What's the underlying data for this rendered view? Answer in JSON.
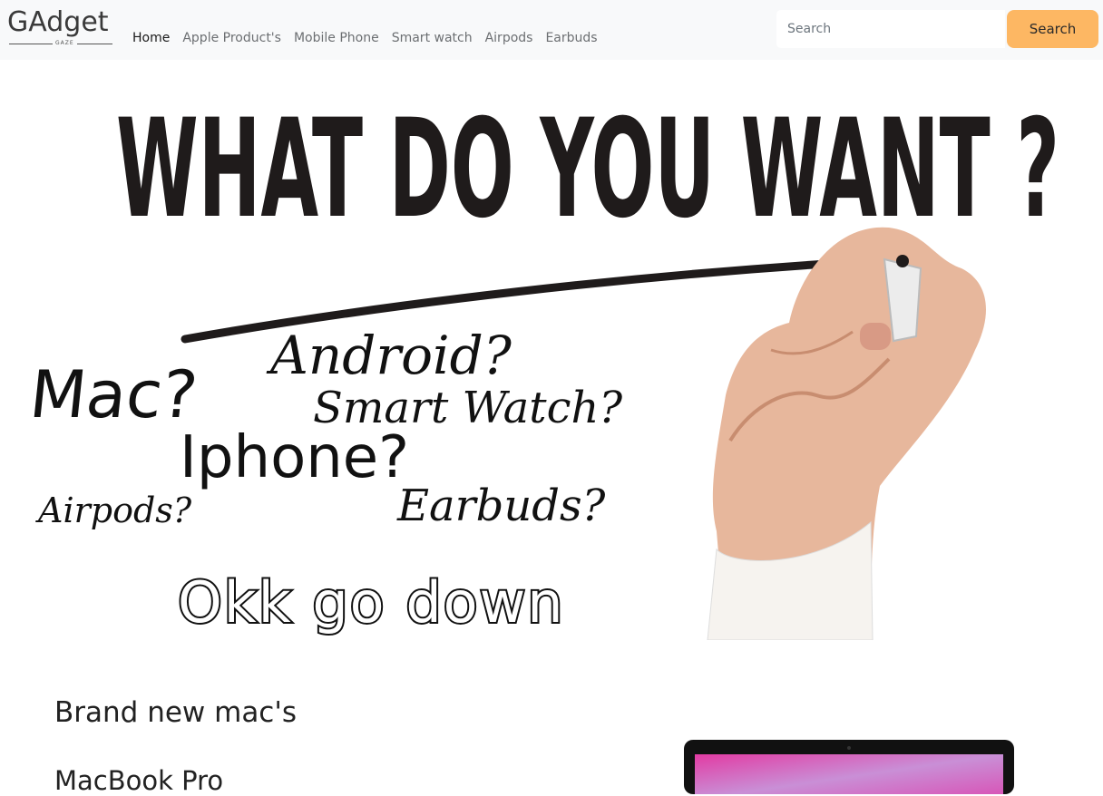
{
  "brand": {
    "name": "GAdget",
    "sub": "GAZE"
  },
  "nav": [
    {
      "label": "Home",
      "active": true
    },
    {
      "label": "Apple Product's",
      "active": false
    },
    {
      "label": "Mobile Phone",
      "active": false
    },
    {
      "label": "Smart watch",
      "active": false
    },
    {
      "label": "Airpods",
      "active": false
    },
    {
      "label": "Earbuds",
      "active": false
    }
  ],
  "search": {
    "placeholder": "Search",
    "button_label": "Search"
  },
  "hero": {
    "headline": "WHAT DO YOU WANT ?",
    "words": {
      "android": "Android?",
      "mac": "Mac?",
      "smartwatch": "Smart Watch?",
      "iphone": "Iphone?",
      "airpods": "Airpods?",
      "earbuds": "Earbuds?"
    },
    "cta": "Okk go down"
  },
  "content": {
    "section_title": "Brand new mac's",
    "product_title": "MacBook Pro"
  },
  "colors": {
    "navbar_bg": "#f8f9fa",
    "search_button": "#fdb763"
  }
}
